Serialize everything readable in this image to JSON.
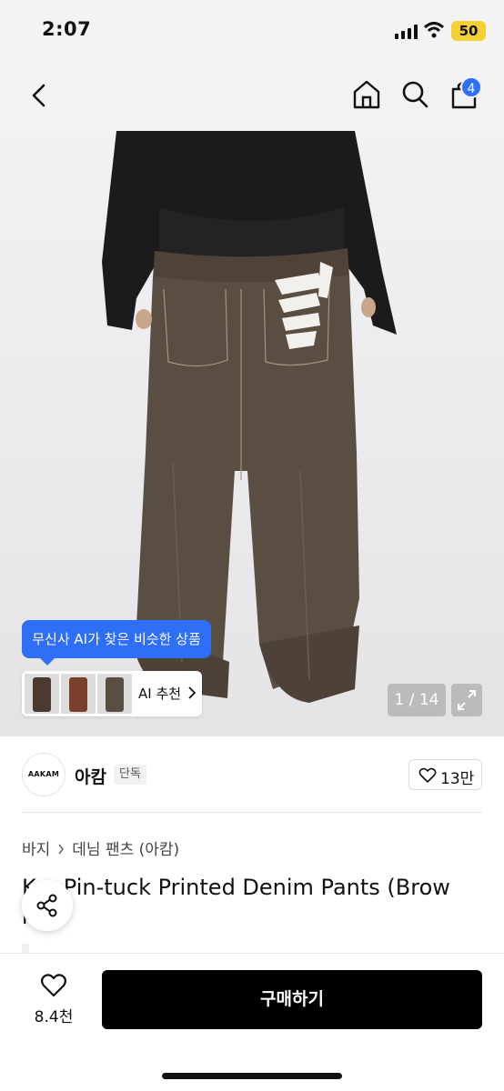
{
  "status_bar": {
    "time": "2:07",
    "battery": "50"
  },
  "nav": {
    "cart_count": "4"
  },
  "gallery": {
    "ai_bubble": "무신사 AI가 찾은 비슷한 상품",
    "ai_label": "AI 추천",
    "ai_thumbnails": [
      "#4a3a30",
      "#7a3e2c",
      "#5a4d42"
    ],
    "counter": "1 / 14"
  },
  "brand": {
    "logo_text": "AAKAM",
    "name": "아캄",
    "tag": "단독",
    "likes": "13만"
  },
  "breadcrumb": [
    "바지",
    "데님 팬츠 (아캄)"
  ],
  "product": {
    "title_line1": "K  e Pin-tuck Printed Denim Pants (Brow",
    "title_line2": "n"
  },
  "bottom_bar": {
    "wish_count": "8.4천",
    "buy_label": "구매하기"
  },
  "colors": {
    "accent": "#2f6ef6",
    "buy_button": "#000000",
    "pants": "#5a4d42"
  }
}
